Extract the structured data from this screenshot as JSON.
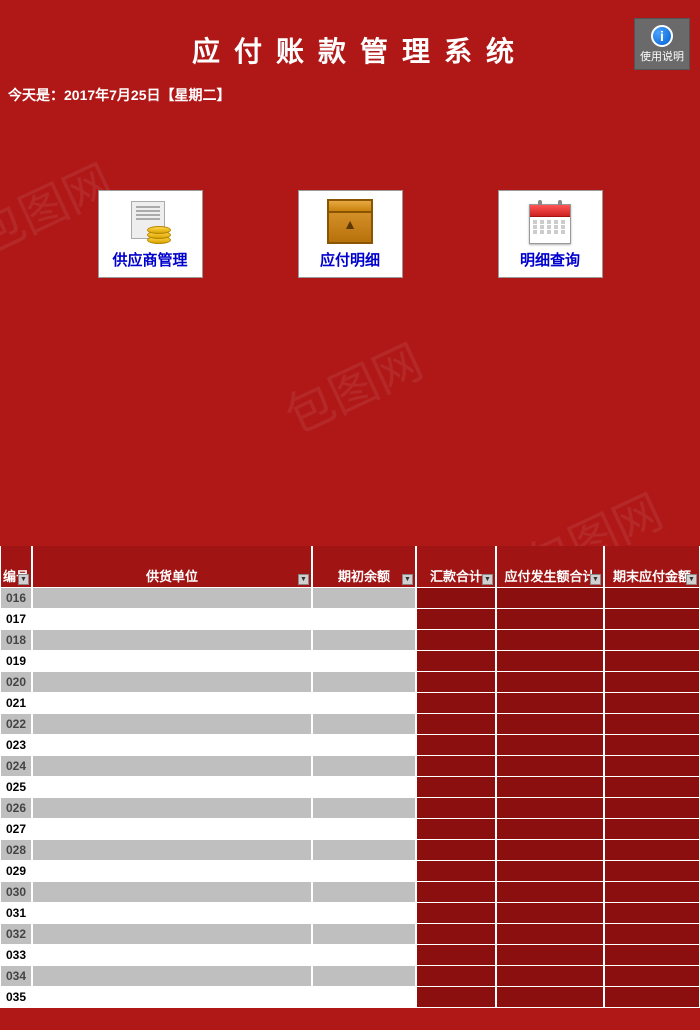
{
  "header": {
    "title": "应付账款管理系统",
    "help_label": "使用说明"
  },
  "date_line": "今天是：2017年7月25日【星期二】",
  "cards": {
    "supplier": "供应商管理",
    "payable": "应付明细",
    "query": "明细查询"
  },
  "table": {
    "headers": {
      "id": "编号",
      "supplier": "供货单位",
      "opening": "期初余额",
      "remit": "汇款合计",
      "payable": "应付发生额合计",
      "ending": "期末应付金额"
    },
    "rows": [
      {
        "id": "016"
      },
      {
        "id": "017"
      },
      {
        "id": "018"
      },
      {
        "id": "019"
      },
      {
        "id": "020"
      },
      {
        "id": "021"
      },
      {
        "id": "022"
      },
      {
        "id": "023"
      },
      {
        "id": "024"
      },
      {
        "id": "025"
      },
      {
        "id": "026"
      },
      {
        "id": "027"
      },
      {
        "id": "028"
      },
      {
        "id": "029"
      },
      {
        "id": "030"
      },
      {
        "id": "031"
      },
      {
        "id": "032"
      },
      {
        "id": "033"
      },
      {
        "id": "034"
      },
      {
        "id": "035"
      }
    ]
  }
}
